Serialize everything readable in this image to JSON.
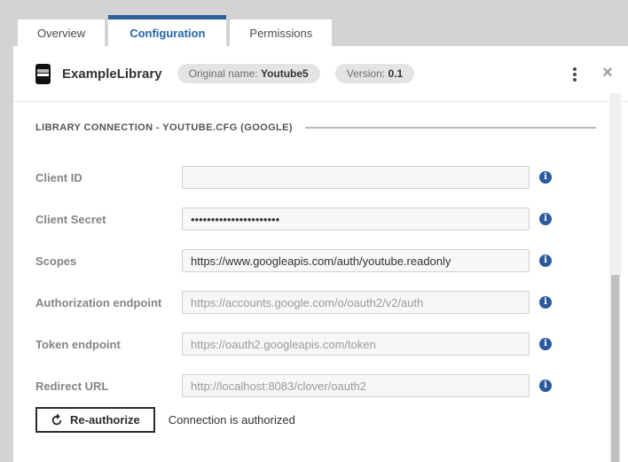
{
  "tabs": [
    {
      "label": "Overview",
      "active": false
    },
    {
      "label": "Configuration",
      "active": true
    },
    {
      "label": "Permissions",
      "active": false
    }
  ],
  "header": {
    "title": "ExampleLibrary",
    "badges": [
      {
        "label": "Original name:",
        "value": "Youtube5"
      },
      {
        "label": "Version:",
        "value": "0.1"
      }
    ],
    "close_glyph": "×"
  },
  "section": {
    "title": "LIBRARY CONNECTION - YOUTUBE.CFG (GOOGLE)"
  },
  "fields": [
    {
      "label": "Client ID",
      "value": "",
      "placeholder": ""
    },
    {
      "label": "Client Secret",
      "value": "••••••••••••••••••••••",
      "placeholder": ""
    },
    {
      "label": "Scopes",
      "value": "https://www.googleapis.com/auth/youtube.readonly",
      "placeholder": ""
    },
    {
      "label": "Authorization endpoint",
      "value": "",
      "placeholder": "https://accounts.google.com/o/oauth2/v2/auth"
    },
    {
      "label": "Token endpoint",
      "value": "",
      "placeholder": "https://oauth2.googleapis.com/token"
    },
    {
      "label": "Redirect URL",
      "value": "",
      "placeholder": "http://localhost:8083/clover/oauth2"
    }
  ],
  "footer": {
    "button_label": "Re-authorize",
    "status_text": "Connection is authorized"
  },
  "icons": {
    "library": "book-icon",
    "menu": "kebab-menu-icon",
    "close": "close-icon",
    "info": "info-icon",
    "refresh": "refresh-icon"
  },
  "colors": {
    "backdrop": "#d3d3d3",
    "active_tab_border": "#2d5f9a",
    "active_tab_text": "#2465a8",
    "info_icon": "#2b5b9e",
    "pill_bg": "#e4e4e4",
    "input_bg": "#f7f7f7",
    "scrollbar_thumb": "#c1c1c1"
  }
}
